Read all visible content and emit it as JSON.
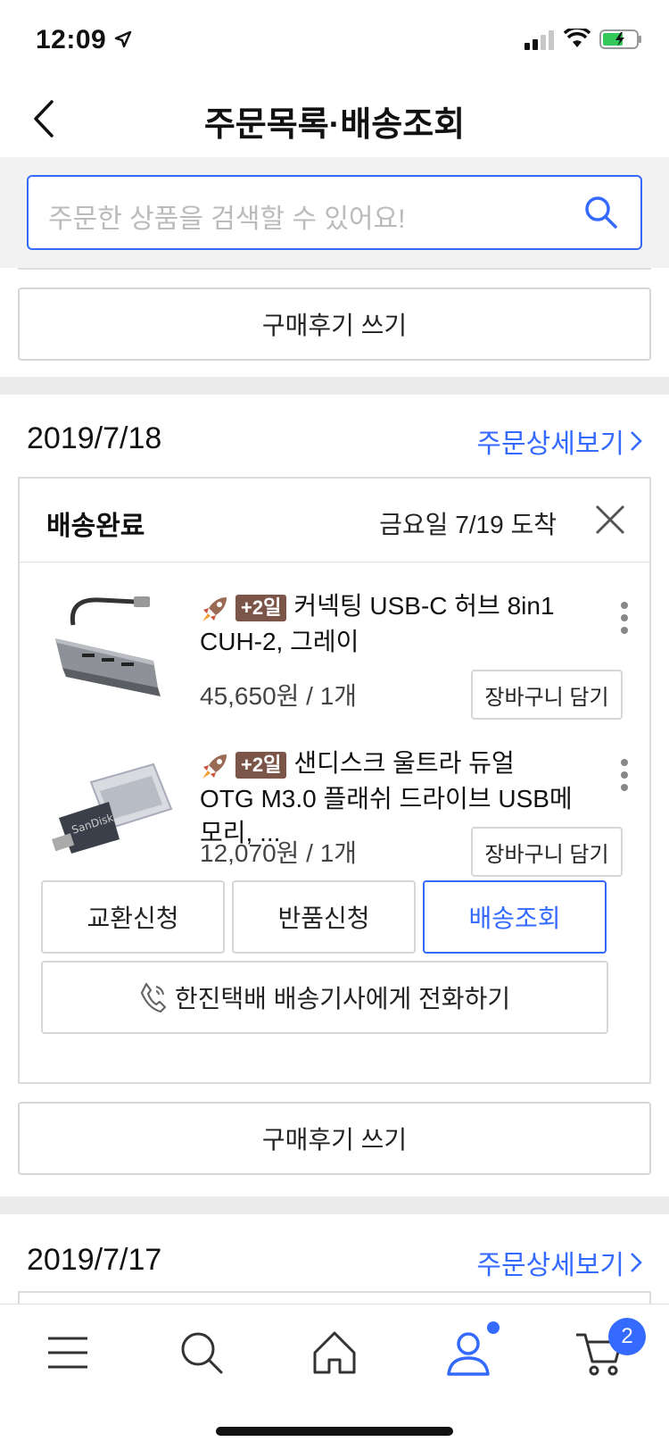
{
  "status_bar": {
    "time": "12:09"
  },
  "nav": {
    "title": "주문목록·배송조회"
  },
  "search": {
    "placeholder": "주문한 상품을 검색할 수 있어요!"
  },
  "review_button_top": "구매후기 쓰기",
  "orders": [
    {
      "date": "2019/7/18",
      "detail_link": "주문상세보기",
      "status": "배송완료",
      "arrival": "금요일 7/19 도착",
      "products": [
        {
          "badge": "+2일",
          "name": "커넥팅 USB-C 허브 8in1 CUH-2, 그레이",
          "price": "45,650원 / 1개",
          "cart_label": "장바구니 담기"
        },
        {
          "badge": "+2일",
          "name": "샌디스크 울트라 듀얼 OTG M3.0 플래쉬 드라이브 USB메모리, ...",
          "price": "12,070원 / 1개",
          "cart_label": "장바구니 담기"
        }
      ],
      "actions": {
        "exchange": "교환신청",
        "return": "반품신청",
        "track": "배송조회"
      },
      "call_label": "한진택배 배송기사에게 전화하기",
      "review_label": "구매후기 쓰기"
    },
    {
      "date": "2019/7/17",
      "detail_link": "주문상세보기"
    }
  ],
  "tab_bar": {
    "items": [
      "menu-icon",
      "search-icon",
      "home-icon",
      "my-page-icon",
      "cart-icon"
    ],
    "cart_count": "2",
    "active_color": "#346aff"
  },
  "colors": {
    "accent": "#346aff",
    "badge": "#7a5548"
  }
}
